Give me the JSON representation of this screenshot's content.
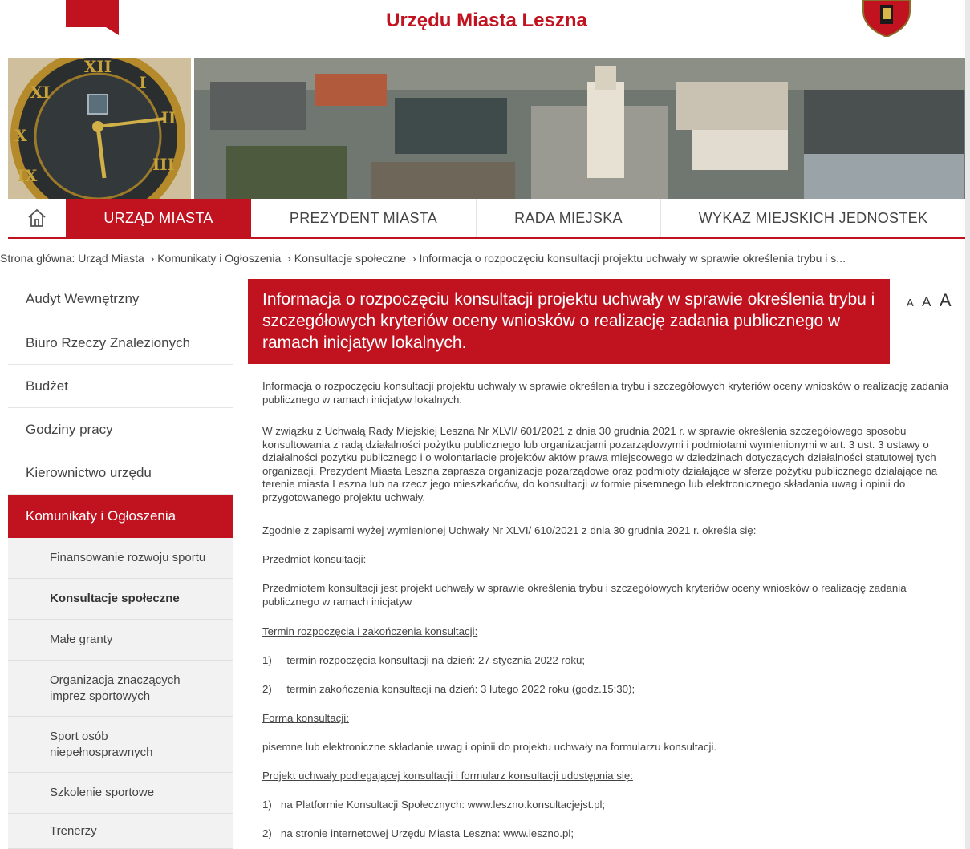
{
  "header": {
    "site_title": "Urzędu Miasta Leszna",
    "brand_color": "#c1121f"
  },
  "nav": {
    "home_icon": "home-icon",
    "items": [
      "URZĄD MIASTA",
      "PREZYDENT MIASTA",
      "RADA MIEJSKA",
      "WYKAZ MIEJSKICH JEDNOSTEK"
    ],
    "active": "URZĄD MIASTA"
  },
  "breadcrumb": [
    "Strona główna: Urząd Miasta",
    "› Komunikaty i Ogłoszenia",
    "› Konsultacje społeczne",
    "› Informacja o rozpoczęciu konsultacji projektu uchwały w sprawie określenia trybu i s..."
  ],
  "sidebar": {
    "items": [
      "Audyt Wewnętrzny",
      "Biuro Rzeczy Znalezionych",
      "Budżet",
      "Godziny pracy",
      "Kierownictwo urzędu",
      "Komunikaty i Ogłoszenia"
    ],
    "subitems": [
      "Finansowanie rozwoju sportu",
      "Konsultacje społeczne",
      "Małe granty",
      "Organizacja znaczących imprez sportowych",
      "Sport osób niepełnosprawnych",
      "Szkolenie sportowe",
      "Trenerzy"
    ]
  },
  "article": {
    "title": "Informacja o rozpoczęciu konsultacji projektu uchwały w sprawie określenia trybu i szczegółowych kryteriów oceny wniosków o realizację zadania publicznego w ramach inicjatyw lokalnych.",
    "font_small": "A",
    "font_medium": "A",
    "font_large": "A",
    "intro": "Informacja o rozpoczęciu konsultacji projektu uchwały w sprawie określenia trybu i szczegółowych kryteriów oceny wniosków o realizację zadania publicznego w ramach inicjatyw lokalnych.",
    "body": "W związku z Uchwałą Rady Miejskiej Leszna Nr XLVI/ 601/2021 z dnia 30 grudnia 2021 r. w sprawie określenia szczegółowego sposobu konsultowania z radą działalności pożytku publicznego lub organizacjami pozarządowymi i podmiotami wymienionymi w art. 3 ust. 3 ustawy o działalności pożytku publicznego i o wolontariacie projektów aktów prawa miejscowego w dziedzinach dotyczących działalności statutowej tych organizacji, Prezydent Miasta Leszna zaprasza organizacje pozarządowe oraz podmioty działające w sferze pożytku publicznego działające na terenie miasta Leszna lub na rzecz jego mieszkańców, do konsultacji w formie pisemnego lub elektronicznego składania uwag i opinii do przygotowanego projektu uchwały.",
    "zgodnie": "Zgodnie z zapisami wyżej wymienionej Uchwały Nr XLVI/ 610/2021 z dnia 30 grudnia 2021 r.  określa się:",
    "przedmiot_heading": "Przedmiot konsultacji:",
    "przedmiot_text": "Przedmiotem konsultacji jest projekt uchwały w sprawie określenia trybu i szczegółowych kryteriów oceny wniosków o realizację zadania publicznego w ramach inicjatyw",
    "termin_heading": "Termin rozpoczęcia i zakończenia konsultacji:",
    "termin_1_num": "1)",
    "termin_1": "termin rozpoczęcia konsultacji na dzień: 27 stycznia 2022 roku;",
    "termin_2_num": "2)",
    "termin_2": "termin zakończenia konsultacji na dzień: 3 lutego 2022 roku (godz.15:30);",
    "forma_heading": "Forma konsultacji:",
    "forma_text": "pisemne lub elektroniczne składanie uwag i opinii do projektu uchwały na formularzu konsultacji.",
    "projekt_heading": "Projekt uchwały podlegającej konsultacji i formularz konsultacji udostępnia się:",
    "projekt_1_num": "1)",
    "projekt_1": "na Platformie Konsultacji Społecznych: www.leszno.konsultacjejst.pl;",
    "projekt_2_num": "2)",
    "projekt_2": "na stronie internetowej Urzędu Miasta Leszna: www.leszno.pl;"
  }
}
